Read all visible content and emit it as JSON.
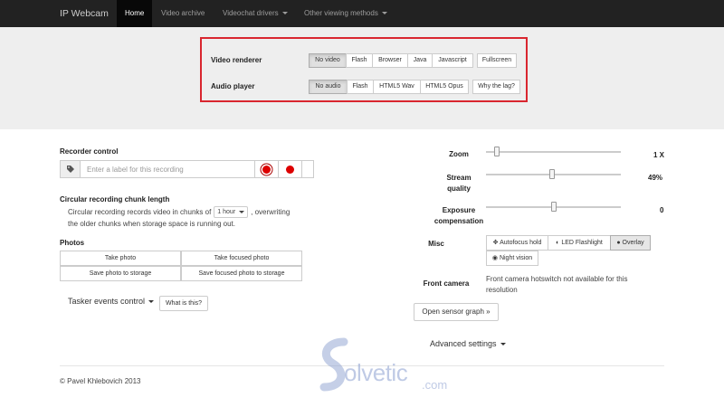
{
  "navbar": {
    "brand": "IP Webcam",
    "items": [
      {
        "label": "Home",
        "active": true
      },
      {
        "label": "Video archive"
      },
      {
        "label": "Videochat drivers"
      },
      {
        "label": "Other viewing methods"
      }
    ]
  },
  "jumbo": {
    "video_renderer": {
      "label": "Video renderer",
      "options": [
        "No video",
        "Flash",
        "Browser",
        "Java",
        "Javascript"
      ],
      "selected": "No video",
      "fullscreen": "Fullscreen"
    },
    "audio_player": {
      "label": "Audio player",
      "options": [
        "No audio",
        "Flash",
        "HTML5 Wav",
        "HTML5 Opus"
      ],
      "selected": "No audio",
      "help": "Why the lag?"
    },
    "highlight_color": "#d9262f"
  },
  "recorder": {
    "title": "Recorder control",
    "label_placeholder": "Enter a label for this recording",
    "tag_icon": "tag-icon",
    "record_color": "#dd0000"
  },
  "chunk": {
    "title": "Circular recording chunk length",
    "text_before": "Circular recording records video in chunks of",
    "selected": "1 hour",
    "text_after": ", overwriting",
    "text_line2": "the older chunks when storage space is running out."
  },
  "photos": {
    "title": "Photos",
    "buttons": [
      "Take photo",
      "Take focused photo",
      "Save photo to storage",
      "Save focused photo to storage"
    ]
  },
  "tasker": {
    "label": "Tasker events control",
    "help": "What is this?"
  },
  "controls": {
    "zoom": {
      "label": "Zoom",
      "value_text": "1 X",
      "level": 0.08
    },
    "stream_quality": {
      "label_line1": "Stream",
      "label_line2": "quality",
      "value_text": "49%",
      "level": 0.49
    },
    "exposure": {
      "label_line1": "Exposure",
      "label_line2": "compensation",
      "value_text": "0",
      "level": 0.5
    },
    "misc": {
      "label": "Misc",
      "autofocus": "Autofocus hold",
      "flashlight": "LED Flashlight",
      "overlay": "Overlay",
      "night_vision": "Night vision"
    },
    "front_camera": {
      "label": "Front camera",
      "text": "Front camera hotswitch not available for this resolution"
    },
    "sensor_graph": "Open sensor graph »",
    "advanced": "Advanced settings"
  },
  "footer": {
    "text": "© Pavel Khlebovich 2013"
  },
  "watermark": {
    "text": "olvetic",
    "suffix": ".com"
  }
}
